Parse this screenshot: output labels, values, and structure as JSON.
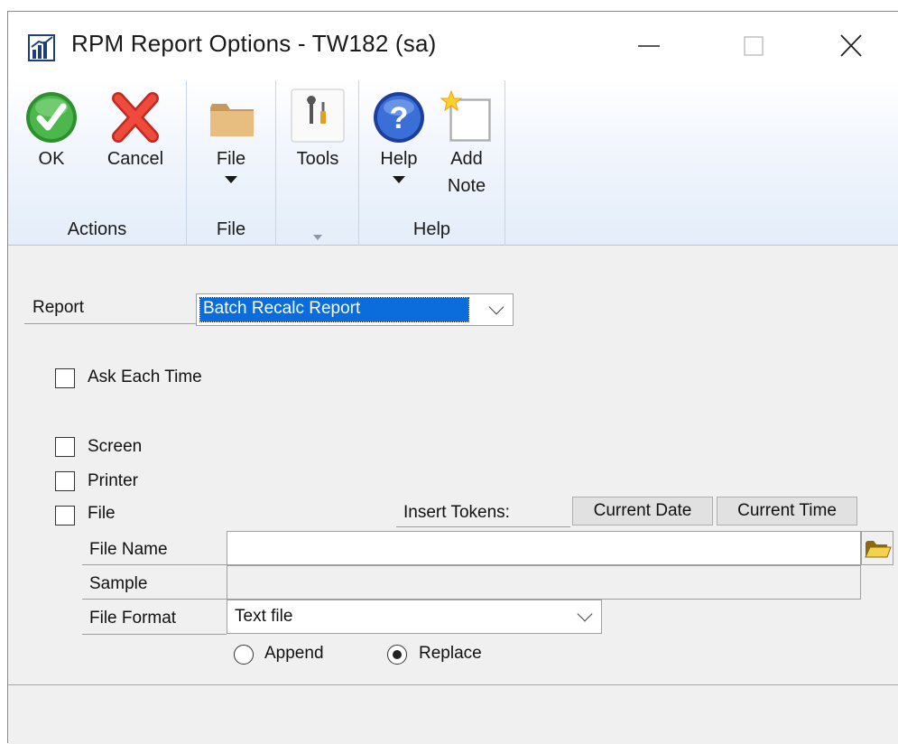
{
  "window": {
    "title": "RPM Report Options  -  TW182 (sa)"
  },
  "ribbon": {
    "actions": {
      "group_label": "Actions",
      "ok_label": "OK",
      "cancel_label": "Cancel"
    },
    "file": {
      "group_label": "File",
      "file_label": "File"
    },
    "tools": {
      "tools_label": "Tools"
    },
    "help": {
      "group_label": "Help",
      "help_label": "Help",
      "add_note_line1": "Add",
      "add_note_line2": "Note"
    }
  },
  "form": {
    "report_label": "Report",
    "report_value": "Batch Recalc Report",
    "ask_each_time_label": "Ask Each Time",
    "ask_each_time_checked": false,
    "screen_label": "Screen",
    "screen_checked": false,
    "printer_label": "Printer",
    "printer_checked": false,
    "file_label": "File",
    "file_checked": false,
    "insert_tokens_label": "Insert Tokens:",
    "current_date_button": "Current Date",
    "current_time_button": "Current Time",
    "file_name_label": "File Name",
    "file_name_value": "",
    "sample_label": "Sample",
    "sample_value": "",
    "file_format_label": "File Format",
    "file_format_value": "Text file",
    "append_label": "Append",
    "replace_label": "Replace",
    "selected_mode": "Replace"
  },
  "colors": {
    "selection": "#0a6ddb",
    "ribbon_top": "#ffffff",
    "ribbon_bottom": "#e4edf9",
    "ok_green": "#3aa33a",
    "cancel_red": "#e23a2e",
    "help_blue": "#2a5cc8"
  },
  "icons": {
    "app": "chart-bar-icon",
    "ok": "check-circle-icon",
    "cancel": "red-x-icon",
    "file": "folder-icon",
    "tools": "tools-icon",
    "help": "help-question-icon",
    "add_note": "note-star-icon",
    "browse": "folder-open-icon"
  }
}
